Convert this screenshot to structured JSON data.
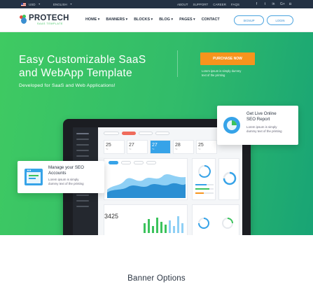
{
  "topbar": {
    "currency": "USD",
    "language": "ENGLISH",
    "links": [
      "ABOUT",
      "SUPPORT",
      "CAREER",
      "FAQS"
    ],
    "social_icons": [
      "facebook-icon",
      "twitter-icon",
      "linkedin-icon",
      "google-plus-icon",
      "instagram-icon"
    ]
  },
  "header": {
    "logo_title": "PROTECH",
    "logo_sub": "SAAS TEMPLATE",
    "nav": [
      {
        "label": "HOME",
        "dropdown": true
      },
      {
        "label": "BANNERS",
        "dropdown": true
      },
      {
        "label": "BLOCKS",
        "dropdown": true
      },
      {
        "label": "BLOG",
        "dropdown": true
      },
      {
        "label": "PAGES",
        "dropdown": true
      },
      {
        "label": "CONTACT",
        "dropdown": false
      }
    ],
    "signup_label": "SIGNUP",
    "login_label": "LOGIN"
  },
  "hero": {
    "title_line1": "Easy Customizable SaaS",
    "title_line2": "and WebApp Template",
    "subtitle": "Developed for SaaS and Web Applications!",
    "cta_label": "PURCHASE NOW",
    "cta_desc_line1": "Lorem ipsum is simply dummy",
    "cta_desc_line2": "text of the printing"
  },
  "card_seo_report": {
    "title_line1": "Get Live Online",
    "title_line2": "SEO Report",
    "desc_line1": "Lorem ipsum is simply",
    "desc_line2": "dummy text of the printing"
  },
  "card_seo_accounts": {
    "title_line1": "Manage your SEO",
    "title_line2": "Accounts",
    "desc_line1": "Lorem ipsum is simply",
    "desc_line2": "dummy text of the printing"
  },
  "dashboard": {
    "stats": [
      {
        "value": "25",
        "unit": "°C"
      },
      {
        "value": "27",
        "unit": "°C"
      },
      {
        "value": "27",
        "unit": "°C"
      },
      {
        "value": "28",
        "unit": "°C"
      },
      {
        "value": "25",
        "unit": "°C"
      }
    ],
    "counter": "3425"
  },
  "section": {
    "title": "Banner Options"
  },
  "colors": {
    "hero_start": "#3fca62",
    "hero_end": "#18a475",
    "cta": "#f7941d",
    "topbar": "#233143",
    "accent_blue": "#36a3e8"
  }
}
